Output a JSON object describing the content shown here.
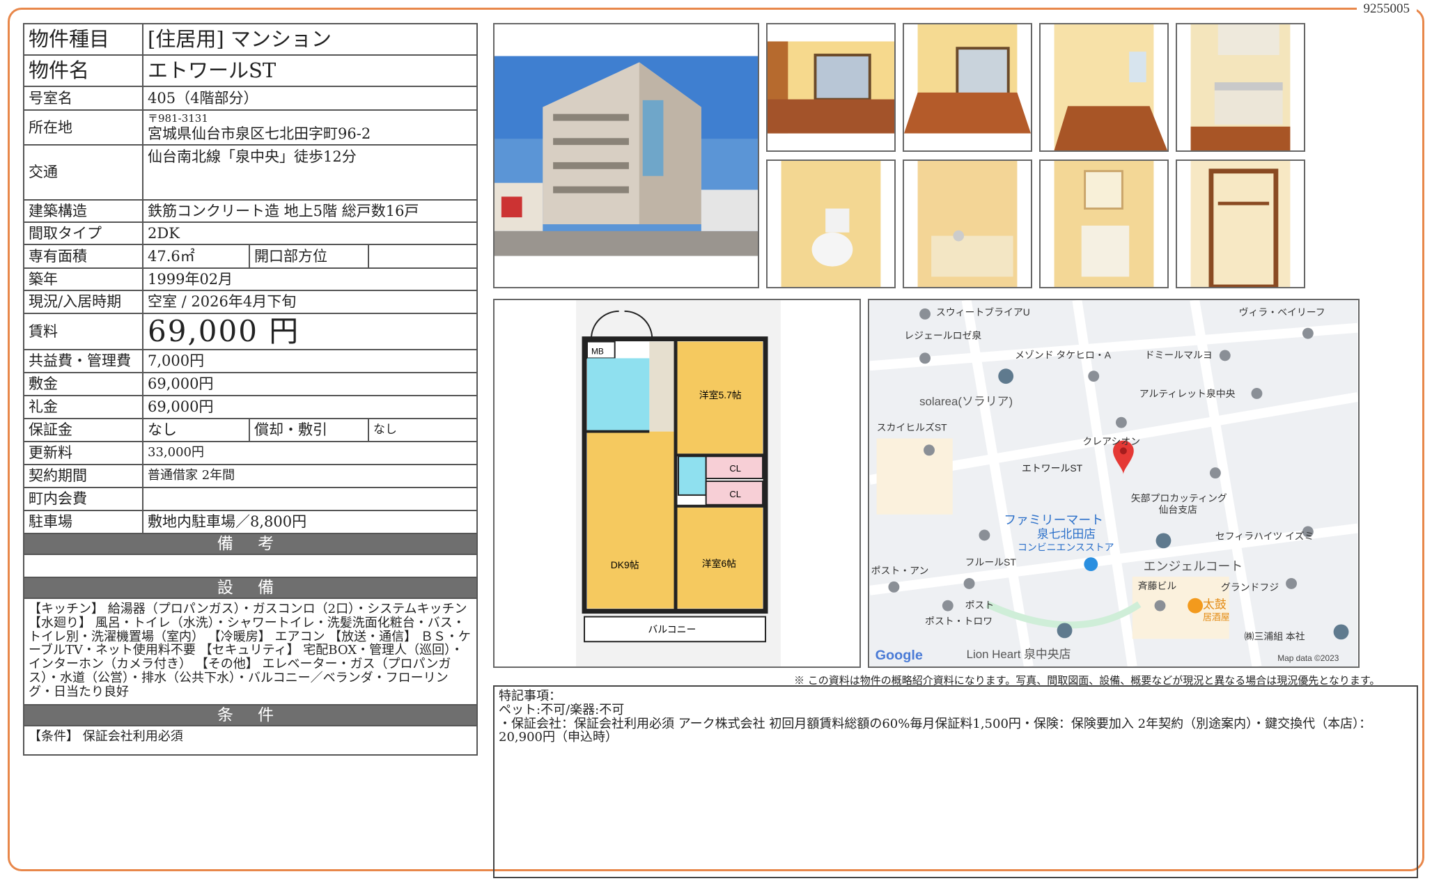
{
  "document_id": "9255005",
  "property": {
    "type_label": "物件種目",
    "type_value": "[住居用]  マンション",
    "name_label": "物件名",
    "name_value": "エトワールST",
    "room_label": "号室名",
    "room_value": "405（4階部分）",
    "address_label": "所在地",
    "postal": "〒981-3131",
    "address": "宮城県仙台市泉区七北田字町96-2",
    "access_label": "交通",
    "access_value": "仙台南北線「泉中央」徒歩12分",
    "structure_label": "建築構造",
    "structure_value": "鉄筋コンクリート造 地上5階 総戸数16戸",
    "layout_label": "間取タイプ",
    "layout_value": "2DK",
    "area_label": "専有面積",
    "area_value": "47.6㎡",
    "direction_label": "開口部方位",
    "direction_value": "",
    "built_label": "築年",
    "built_value": "1999年02月",
    "status_label": "現況/入居時期",
    "status_value": "空室  /  2026年4月下旬",
    "rent_label": "賃料",
    "rent_value": "69,000 円",
    "fee_label": "共益費・管理費",
    "fee_value": "7,000円",
    "deposit_label": "敷金",
    "deposit_value": "69,000円",
    "keymoney_label": "礼金",
    "keymoney_value": "69,000円",
    "guarantee_label": "保証金",
    "guarantee_value": "なし",
    "amort_label": "償却・敷引",
    "amort_value": "なし",
    "renewal_label": "更新料",
    "renewal_value": "33,000円",
    "contract_label": "契約期間",
    "contract_value": "普通借家 2年間",
    "town_label": "町内会費",
    "town_value": "",
    "parking_label": "駐車場",
    "parking_value": "敷地内駐車場／8,800円"
  },
  "sections": {
    "remarks_header": "備 考",
    "remarks_text": "",
    "equipment_header": "設 備",
    "equipment_text": "【キッチン】 給湯器（プロパンガス）・ガスコンロ（2口）・システムキッチン 【水廻り】 風呂・トイレ（水洗）・シャワートイレ・洗髪洗面化粧台・バス・トイレ別・洗濯機置場（室内） 【冷暖房】 エアコン 【放送・通信】 ＢＳ・ケーブルTV・ネット使用料不要 【セキュリティ】 宅配BOX・管理人（巡回）・インターホン（カメラ付き） 【その他】 エレベーター・ガス（プロパンガス）・水道（公営）・排水（公共下水）・バルコニー／ベランダ・フローリング・日当たり良好",
    "conditions_header": "条 件",
    "conditions_text": "【条件】 保証会社利用必須"
  },
  "floorplan": {
    "mb": "MB",
    "room1": "洋室5.7帖",
    "room2": "洋室6帖",
    "dk": "DK9帖",
    "cl1": "CL",
    "cl2": "CL",
    "balcony": "バルコニー"
  },
  "map": {
    "labels": [
      "スウィートブライアU",
      "ヴィラ・ベイリーフ",
      "レジェールロゼ泉",
      "メゾンド タケヒロ・A",
      "ドミールマルヨ",
      "solarea(ソラリア)",
      "アルティレット泉中央",
      "スカイヒルズST",
      "クレアシオン",
      "エトワールST",
      "矢部プロカッティング",
      "仙台支店",
      "ファミリーマート",
      "泉七北田店",
      "コンビニエンスストア",
      "セフィラハイツ イズミ",
      "フルールST",
      "エンジェルコート",
      "ポスト・アン",
      "斉藤ビル",
      "グランドフジ",
      "ポスト",
      "ポスト・トロワ",
      "太鼓",
      "居酒屋",
      "Lion Heart 泉中央店",
      "㈱三浦組 本社"
    ],
    "google": "Google",
    "mapdata": "Map data ©2023"
  },
  "notice": "※ この資料は物件の概略紹介資料になります。写真、間取図面、設備、概要などが現況と異なる場合は現況優先となります。",
  "special": {
    "title": "特記事項：",
    "line1": "ペット:不可/楽器:不可",
    "line2": "・保証会社：保証会社利用必須 アーク株式会社 初回月額賃料総額の60%毎月保証料1,500円・保険：保険要加入 2年契約（別途案内）・鍵交換代（本店）：20,900円（申込時）"
  },
  "colors": {
    "frame": "#e8874a",
    "section_bg": "#6f6f6f",
    "floor_wood": "#f5c95f",
    "map_pin": "#e53935"
  }
}
